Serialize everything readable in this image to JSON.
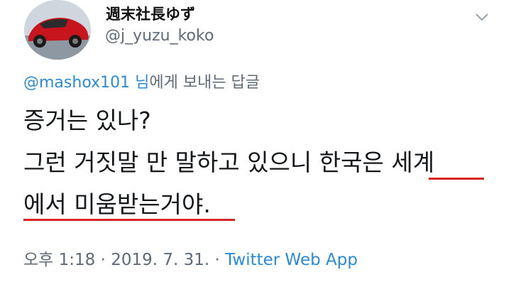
{
  "author": {
    "display_name": "週末社長ゆず",
    "handle": "@j_yuzu_koko"
  },
  "reply_context": {
    "mention": "@mashox101",
    "suffix_name": "님",
    "suffix_text": "에게 보내는 답글"
  },
  "tweet": {
    "line1": "증거는 있나?",
    "line2": "그런 거짓말 만 말하고 있으니 한국은 세계",
    "line3": "에서 미움받는거야."
  },
  "meta": {
    "time": "오후 1:18",
    "separator1": " · ",
    "date": "2019. 7. 31.",
    "separator2": " · ",
    "source": "Twitter Web App"
  },
  "colors": {
    "link": "#2a8bd8",
    "secondary_text": "#5d6b78",
    "highlight_underline": "#d92424"
  },
  "icons": {
    "avatar": "red-sports-car-avatar",
    "menu": "chevron-down-icon"
  }
}
